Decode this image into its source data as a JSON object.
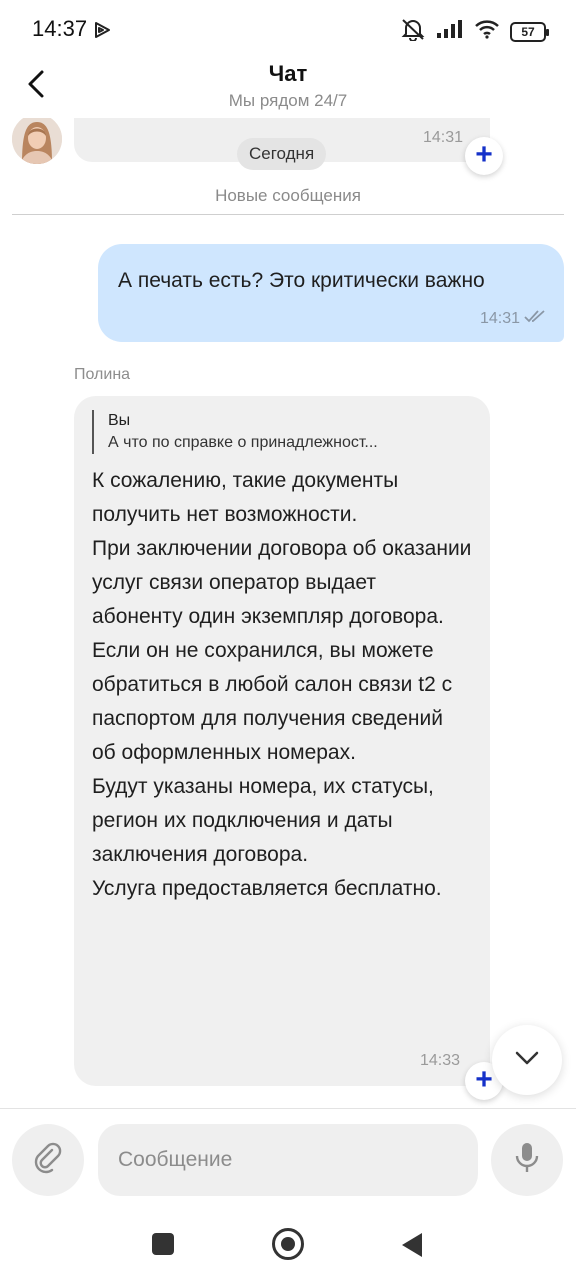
{
  "status_bar": {
    "time": "14:37",
    "battery": "57"
  },
  "header": {
    "title": "Чат",
    "subtitle": "Мы рядом 24/7"
  },
  "chat": {
    "previous_message": {
      "time": "14:31"
    },
    "date_chip": "Сегодня",
    "new_messages_label": "Новые сообщения",
    "outgoing": {
      "text": "А печать есть? Это критически важно",
      "time": "14:31"
    },
    "incoming": {
      "sender": "Полина",
      "reply_author": "Вы",
      "reply_text": "А что по справке о принадлежност...",
      "text": "К сожалению, такие документы получить нет возможности.\nПри заключении договора об оказании услуг связи оператор выдает абоненту один экземпляр договора.\nЕсли он не сохранился, вы можете обратиться в любой салон связи t2 с паспортом для получения сведений об оформленных номерах.\nБудут указаны номера, их статусы, регион их подключения и даты заключения договора.\nУслуга предоставляется бесплатно.",
      "time": "14:33"
    }
  },
  "composer": {
    "placeholder": "Сообщение"
  },
  "icons": {
    "back": "chevron-left-icon",
    "attach": "paperclip-icon",
    "mic": "microphone-icon",
    "scroll_down": "chevron-down-icon",
    "add_reaction": "plus-icon"
  },
  "colors": {
    "outgoing_bubble": "#cfe6fe",
    "incoming_bubble": "#f0f0f0",
    "accent": "#1531c9"
  }
}
